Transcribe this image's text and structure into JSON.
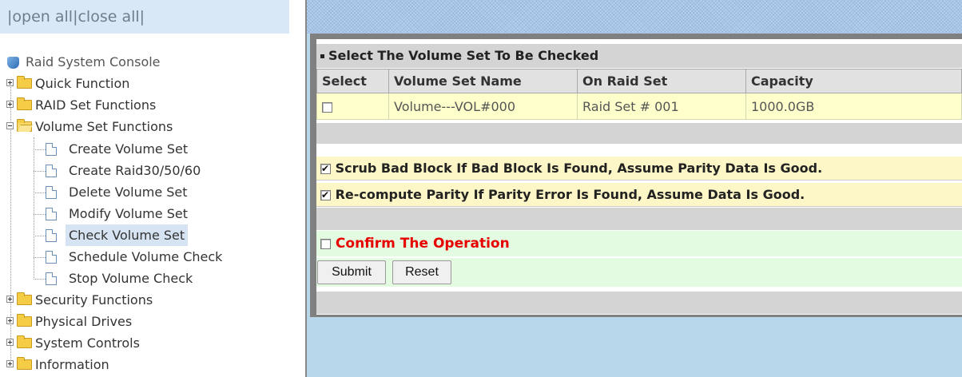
{
  "sidebar": {
    "open_all": "open all",
    "close_all": "close all",
    "console": "Raid System Console",
    "items": {
      "quick_function": "Quick Function",
      "raid_set_functions": "RAID Set Functions",
      "volume_set_functions": "Volume Set Functions",
      "create_volume_set": "Create Volume Set",
      "create_raid": "Create Raid30/50/60",
      "delete_volume_set": "Delete Volume Set",
      "modify_volume_set": "Modify Volume Set",
      "check_volume_set": "Check Volume Set",
      "schedule_volume_check": "Schedule Volume Check",
      "stop_volume_check": "Stop Volume Check",
      "security_functions": "Security Functions",
      "physical_drives": "Physical Drives",
      "system_controls": "System Controls",
      "information": "Information"
    }
  },
  "main": {
    "section_title": "Select The Volume Set To Be Checked",
    "table": {
      "headers": [
        "Select",
        "Volume Set Name",
        "On Raid Set",
        "Capacity"
      ],
      "rows": [
        {
          "name": "Volume---VOL#000",
          "raid_set": "Raid Set # 001",
          "capacity": "1000.0GB",
          "selected": false
        }
      ]
    },
    "options": {
      "scrub_label": "Scrub Bad Block If Bad Block Is Found, Assume Parity Data Is Good.",
      "scrub_checked": true,
      "recompute_label": "Re-compute Parity If Parity Error Is Found, Assume Data Is Good.",
      "recompute_checked": true
    },
    "confirm_label": "Confirm The Operation",
    "confirm_checked": false,
    "submit_label": "Submit",
    "reset_label": "Reset"
  },
  "colors": {
    "confirm_text": "#e60000",
    "options_bg": "#fdf6c6",
    "confirm_bg": "#e3fbe0",
    "sidebar_header_bg": "#d9e8f6",
    "right_bg": "#b9d7ea"
  }
}
